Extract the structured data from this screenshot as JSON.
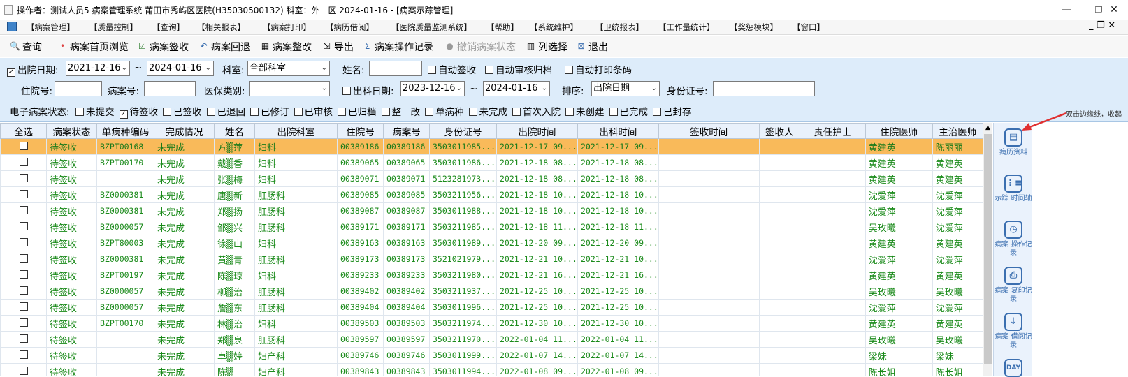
{
  "window": {
    "title": "操作者：测试人员5 病案管理系统  莆田市秀屿区医院(H35030500132)  科室：外一区 2024-01-16  - [病案示踪管理]",
    "minimize": "—",
    "maximize": "❐",
    "close": "✕"
  },
  "menu": {
    "items": [
      "【病案管理】",
      "【质量控制】",
      "【查询】",
      "【相关报表】",
      "【病案打印】",
      "【病历借阅】",
      "【医院质量监测系统】",
      "【帮助】",
      "【系统维护】",
      "【卫统报表】",
      "【工作量统计】",
      "【奖惩模块】",
      "【窗口】"
    ],
    "mdi": "_ ❐ ✕"
  },
  "toolbar": {
    "query": "查询",
    "first_page": "病案首页浏览",
    "sign": "病案签收",
    "return": "病案回退",
    "rectify": "病案整改",
    "export": "导出",
    "op_log": "病案操作记录",
    "revoke": "撤销病案状态",
    "col_select": "列选择",
    "exit": "退出"
  },
  "filter": {
    "discharge_date_label": "出院日期:",
    "discharge_from": "2021-12-16",
    "tilde": "~",
    "discharge_to": "2024-01-16",
    "dept_label": "科室:",
    "dept_value": "全部科室",
    "name_label": "姓名:",
    "name_value": "",
    "auto_sign": "自动签收",
    "auto_audit": "自动审核归档",
    "auto_barcode": "自动打印条码",
    "inpatient_no_label": "住院号:",
    "record_no_label": "病案号:",
    "insurance_label": "医保类别:",
    "leave_dept_label": "出科日期:",
    "leave_from": "2023-12-16",
    "leave_to": "2024-01-16",
    "sort_label": "排序:",
    "sort_value": "出院日期",
    "id_label": "身份证号:",
    "status_label": "电子病案状态:",
    "statuses": [
      "未提交",
      "待签收",
      "已签收",
      "已退回",
      "已修订",
      "已审核",
      "已归档",
      "整　改",
      "单病种",
      "未完成",
      "首次入院",
      "未创建",
      "已完成",
      "已封存"
    ],
    "status_checked": [
      false,
      true,
      false,
      false,
      false,
      false,
      false,
      false,
      false,
      false,
      false,
      false,
      false,
      false
    ]
  },
  "grid": {
    "headers": [
      "全选",
      "病案状态",
      "单病种编码",
      "完成情况",
      "姓名",
      "出院科室",
      "住院号",
      "病案号",
      "身份证号",
      "出院时间",
      "出科时间",
      "签收时间",
      "签收人",
      "责任护士",
      "住院医师",
      "主治医师"
    ],
    "rows": [
      [
        "待签收",
        "BZPT00168",
        "未完成",
        "方▒萍",
        "妇科",
        "00389186",
        "00389186",
        "3503011985...",
        "2021-12-17 09...",
        "2021-12-17 09...",
        "",
        "",
        "",
        "黄建英",
        "陈丽丽"
      ],
      [
        "待签收",
        "BZPT00170",
        "未完成",
        "戴▒香",
        "妇科",
        "00389065",
        "00389065",
        "3503011986...",
        "2021-12-18 08...",
        "2021-12-18 08...",
        "",
        "",
        "",
        "黄建英",
        "黄建英"
      ],
      [
        "待签收",
        "",
        "未完成",
        "张▒梅",
        "妇科",
        "00389071",
        "00389071",
        "5123281973...",
        "2021-12-18 08...",
        "2021-12-18 08...",
        "",
        "",
        "",
        "黄建英",
        "黄建英"
      ],
      [
        "待签收",
        "BZ0000381",
        "未完成",
        "唐▒新",
        "肛肠科",
        "00389085",
        "00389085",
        "3503211956...",
        "2021-12-18 10...",
        "2021-12-18 10...",
        "",
        "",
        "",
        "沈爱萍",
        "沈爱萍"
      ],
      [
        "待签收",
        "BZ0000381",
        "未完成",
        "郑▒扬",
        "肛肠科",
        "00389087",
        "00389087",
        "3503011988...",
        "2021-12-18 10...",
        "2021-12-18 10...",
        "",
        "",
        "",
        "沈爱萍",
        "沈爱萍"
      ],
      [
        "待签收",
        "BZ0000057",
        "未完成",
        "邹▒兴",
        "肛肠科",
        "00389171",
        "00389171",
        "3503211985...",
        "2021-12-18 11...",
        "2021-12-18 11...",
        "",
        "",
        "",
        "吴玫曦",
        "沈爱萍"
      ],
      [
        "待签收",
        "BZPT80003",
        "未完成",
        "徐▒山",
        "妇科",
        "00389163",
        "00389163",
        "3503011989...",
        "2021-12-20 09...",
        "2021-12-20 09...",
        "",
        "",
        "",
        "黄建英",
        "黄建英"
      ],
      [
        "待签收",
        "BZ0000381",
        "未完成",
        "黄▒青",
        "肛肠科",
        "00389173",
        "00389173",
        "3521021979...",
        "2021-12-21 10...",
        "2021-12-21 10...",
        "",
        "",
        "",
        "沈爱萍",
        "沈爱萍"
      ],
      [
        "待签收",
        "BZPT00197",
        "未完成",
        "陈▒琼",
        "妇科",
        "00389233",
        "00389233",
        "3503211980...",
        "2021-12-21 16...",
        "2021-12-21 16...",
        "",
        "",
        "",
        "黄建英",
        "黄建英"
      ],
      [
        "待签收",
        "BZ0000057",
        "未完成",
        "柳▒治",
        "肛肠科",
        "00389402",
        "00389402",
        "3503211937...",
        "2021-12-25 10...",
        "2021-12-25 10...",
        "",
        "",
        "",
        "吴玫曦",
        "吴玫曦"
      ],
      [
        "待签收",
        "BZ0000057",
        "未完成",
        "詹▒东",
        "肛肠科",
        "00389404",
        "00389404",
        "3503011996...",
        "2021-12-25 10...",
        "2021-12-25 10...",
        "",
        "",
        "",
        "沈爱萍",
        "沈爱萍"
      ],
      [
        "待签收",
        "BZPT00170",
        "未完成",
        "林▒治",
        "妇科",
        "00389503",
        "00389503",
        "3503211974...",
        "2021-12-30 10...",
        "2021-12-30 10...",
        "",
        "",
        "",
        "黄建英",
        "黄建英"
      ],
      [
        "待签收",
        "",
        "未完成",
        "郑▒泉",
        "肛肠科",
        "00389597",
        "00389597",
        "3503211970...",
        "2022-01-04 11...",
        "2022-01-04 11...",
        "",
        "",
        "",
        "吴玫曦",
        "吴玫曦"
      ],
      [
        "待签收",
        "",
        "未完成",
        "卓▒婷",
        "妇产科",
        "00389746",
        "00389746",
        "3503011999...",
        "2022-01-07 14...",
        "2022-01-07 14...",
        "",
        "",
        "",
        "梁妹",
        "梁妹"
      ],
      [
        "待签收",
        "",
        "未完成",
        "陈▒",
        "妇产科",
        "00389843",
        "00389843",
        "3503011994...",
        "2022-01-08 09...",
        "2022-01-08 09...",
        "",
        "",
        "",
        "陈长姐",
        "陈长姐"
      ]
    ]
  },
  "side": {
    "items": [
      {
        "icon": "▤",
        "label": "病历资料",
        "name": "medical-record-icon"
      },
      {
        "icon": "⋮≡",
        "label": "示踪 时间轴",
        "name": "timeline-icon"
      },
      {
        "icon": "◷",
        "label": "病案 操作记录",
        "name": "operation-log-icon"
      },
      {
        "icon": "⎙",
        "label": "病案 复印记录",
        "name": "printer-icon"
      },
      {
        "icon": "↓",
        "label": "病案 借阅记录",
        "name": "borrow-icon"
      },
      {
        "icon": "DAY",
        "label": "",
        "name": "calendar-icon"
      }
    ],
    "hint": "双击边缘线，收起"
  }
}
